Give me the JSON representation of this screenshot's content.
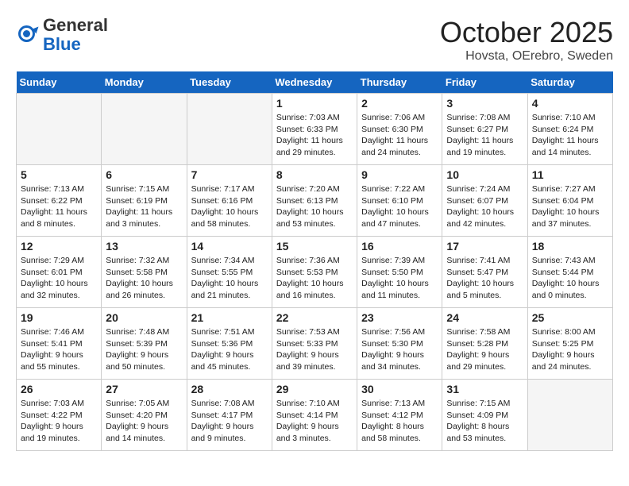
{
  "header": {
    "logo_general": "General",
    "logo_blue": "Blue",
    "month_title": "October 2025",
    "location": "Hovsta, OErebro, Sweden"
  },
  "days_of_week": [
    "Sunday",
    "Monday",
    "Tuesday",
    "Wednesday",
    "Thursday",
    "Friday",
    "Saturday"
  ],
  "weeks": [
    [
      {
        "day": "",
        "empty": true
      },
      {
        "day": "",
        "empty": true
      },
      {
        "day": "",
        "empty": true
      },
      {
        "day": "1",
        "sunrise": "7:03 AM",
        "sunset": "6:33 PM",
        "daylight": "11 hours and 29 minutes."
      },
      {
        "day": "2",
        "sunrise": "7:06 AM",
        "sunset": "6:30 PM",
        "daylight": "11 hours and 24 minutes."
      },
      {
        "day": "3",
        "sunrise": "7:08 AM",
        "sunset": "6:27 PM",
        "daylight": "11 hours and 19 minutes."
      },
      {
        "day": "4",
        "sunrise": "7:10 AM",
        "sunset": "6:24 PM",
        "daylight": "11 hours and 14 minutes."
      }
    ],
    [
      {
        "day": "5",
        "sunrise": "7:13 AM",
        "sunset": "6:22 PM",
        "daylight": "11 hours and 8 minutes."
      },
      {
        "day": "6",
        "sunrise": "7:15 AM",
        "sunset": "6:19 PM",
        "daylight": "11 hours and 3 minutes."
      },
      {
        "day": "7",
        "sunrise": "7:17 AM",
        "sunset": "6:16 PM",
        "daylight": "10 hours and 58 minutes."
      },
      {
        "day": "8",
        "sunrise": "7:20 AM",
        "sunset": "6:13 PM",
        "daylight": "10 hours and 53 minutes."
      },
      {
        "day": "9",
        "sunrise": "7:22 AM",
        "sunset": "6:10 PM",
        "daylight": "10 hours and 47 minutes."
      },
      {
        "day": "10",
        "sunrise": "7:24 AM",
        "sunset": "6:07 PM",
        "daylight": "10 hours and 42 minutes."
      },
      {
        "day": "11",
        "sunrise": "7:27 AM",
        "sunset": "6:04 PM",
        "daylight": "10 hours and 37 minutes."
      }
    ],
    [
      {
        "day": "12",
        "sunrise": "7:29 AM",
        "sunset": "6:01 PM",
        "daylight": "10 hours and 32 minutes."
      },
      {
        "day": "13",
        "sunrise": "7:32 AM",
        "sunset": "5:58 PM",
        "daylight": "10 hours and 26 minutes."
      },
      {
        "day": "14",
        "sunrise": "7:34 AM",
        "sunset": "5:55 PM",
        "daylight": "10 hours and 21 minutes."
      },
      {
        "day": "15",
        "sunrise": "7:36 AM",
        "sunset": "5:53 PM",
        "daylight": "10 hours and 16 minutes."
      },
      {
        "day": "16",
        "sunrise": "7:39 AM",
        "sunset": "5:50 PM",
        "daylight": "10 hours and 11 minutes."
      },
      {
        "day": "17",
        "sunrise": "7:41 AM",
        "sunset": "5:47 PM",
        "daylight": "10 hours and 5 minutes."
      },
      {
        "day": "18",
        "sunrise": "7:43 AM",
        "sunset": "5:44 PM",
        "daylight": "10 hours and 0 minutes."
      }
    ],
    [
      {
        "day": "19",
        "sunrise": "7:46 AM",
        "sunset": "5:41 PM",
        "daylight": "9 hours and 55 minutes."
      },
      {
        "day": "20",
        "sunrise": "7:48 AM",
        "sunset": "5:39 PM",
        "daylight": "9 hours and 50 minutes."
      },
      {
        "day": "21",
        "sunrise": "7:51 AM",
        "sunset": "5:36 PM",
        "daylight": "9 hours and 45 minutes."
      },
      {
        "day": "22",
        "sunrise": "7:53 AM",
        "sunset": "5:33 PM",
        "daylight": "9 hours and 39 minutes."
      },
      {
        "day": "23",
        "sunrise": "7:56 AM",
        "sunset": "5:30 PM",
        "daylight": "9 hours and 34 minutes."
      },
      {
        "day": "24",
        "sunrise": "7:58 AM",
        "sunset": "5:28 PM",
        "daylight": "9 hours and 29 minutes."
      },
      {
        "day": "25",
        "sunrise": "8:00 AM",
        "sunset": "5:25 PM",
        "daylight": "9 hours and 24 minutes."
      }
    ],
    [
      {
        "day": "26",
        "sunrise": "7:03 AM",
        "sunset": "4:22 PM",
        "daylight": "9 hours and 19 minutes."
      },
      {
        "day": "27",
        "sunrise": "7:05 AM",
        "sunset": "4:20 PM",
        "daylight": "9 hours and 14 minutes."
      },
      {
        "day": "28",
        "sunrise": "7:08 AM",
        "sunset": "4:17 PM",
        "daylight": "9 hours and 9 minutes."
      },
      {
        "day": "29",
        "sunrise": "7:10 AM",
        "sunset": "4:14 PM",
        "daylight": "9 hours and 3 minutes."
      },
      {
        "day": "30",
        "sunrise": "7:13 AM",
        "sunset": "4:12 PM",
        "daylight": "8 hours and 58 minutes."
      },
      {
        "day": "31",
        "sunrise": "7:15 AM",
        "sunset": "4:09 PM",
        "daylight": "8 hours and 53 minutes."
      },
      {
        "day": "",
        "empty": true
      }
    ]
  ]
}
